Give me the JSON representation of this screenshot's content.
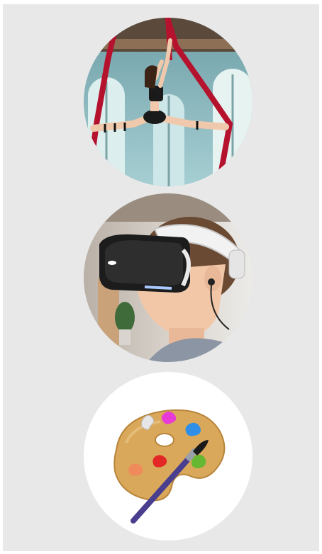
{
  "categories": [
    {
      "icon": "aerial-silks-dancer-photo"
    },
    {
      "icon": "vr-headset-child-photo"
    },
    {
      "icon": "paint-palette-icon"
    }
  ],
  "colors": {
    "panel_background": "#e8e8e8",
    "silk_red": "#b5122e",
    "palette_wood": "#d9a85a",
    "brush_handle": "#4a3f8f"
  }
}
